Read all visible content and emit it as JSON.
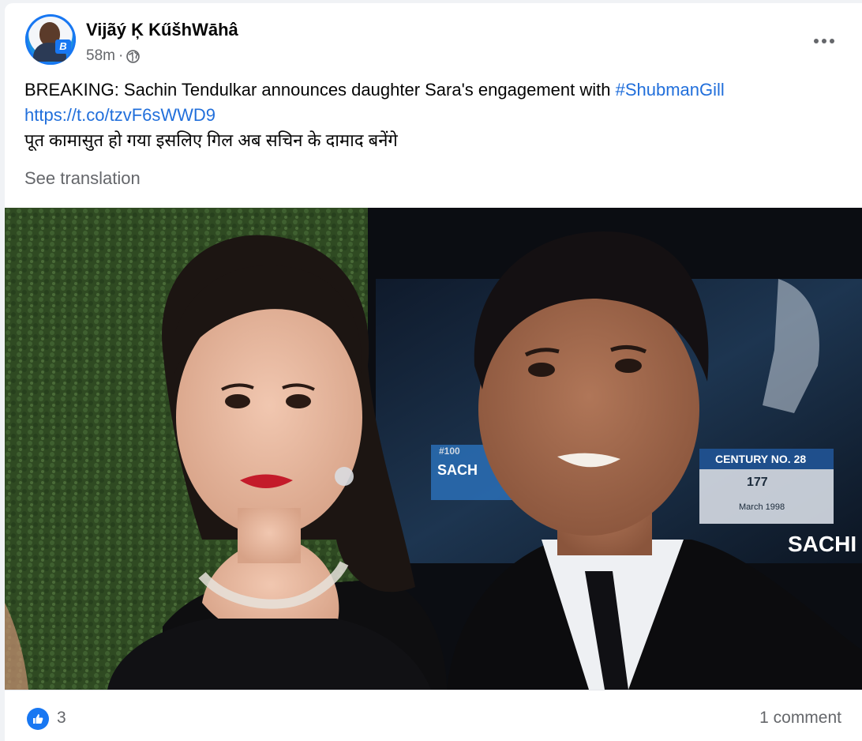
{
  "post": {
    "author": "Vijãý Ķ KűšhWāhâ",
    "time": "58m",
    "separator": "·",
    "audience_icon": "globe-icon",
    "more_icon": "more-options-icon",
    "text": {
      "line1_prefix": "BREAKING: Sachin Tendulkar announces daughter Sara's engagement with ",
      "hashtag": "#ShubmanGill",
      "link": "https://t.co/tzvF6sWWD9",
      "line3": "पूत कामासुत हो गया इसलिए गिल अब सचिन के दामाद बनेंगे"
    },
    "see_translation": "See translation",
    "photo": {
      "backdrop_text_1": "CENTURY NO. 28",
      "backdrop_text_2": "177",
      "backdrop_text_3": "SACH",
      "backdrop_text_4": "SACHI",
      "backdrop_text_5": "#100",
      "backdrop_text_6": "March 1998"
    },
    "reactions": {
      "like_icon": "like-icon",
      "count": "3"
    },
    "comments": "1 comment"
  },
  "colors": {
    "link": "#216fdb",
    "secondary_text": "#65676b",
    "like_blue": "#1877f2"
  }
}
